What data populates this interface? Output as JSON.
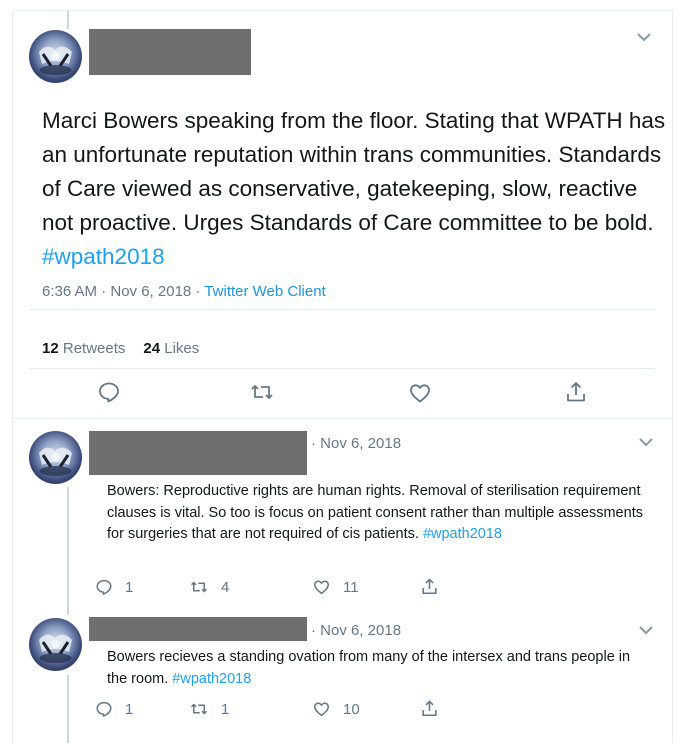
{
  "main_tweet": {
    "text": "Marci Bowers speaking from the floor. Stating that WPATH has an unfortunate reputation within trans communities. Standards of Care viewed as conservative, gatekeeping, slow, reactive not proactive. Urges Standards of Care committee to be bold.",
    "hashtag": "#wpath2018",
    "time": "6:36 AM · Nov 6, 2018 · ",
    "client": "Twitter Web Client",
    "retweets_count": "12",
    "retweets_label": "Retweets",
    "likes_count": "24",
    "likes_label": "Likes",
    "actions": [
      "reply-icon",
      "retweet-icon",
      "like-icon",
      "share-icon"
    ]
  },
  "replies": [
    {
      "date": "· Nov 6, 2018",
      "text": "Bowers: Reproductive rights are human rights. Removal of sterilisation requirement clauses is vital. So too is focus on patient consent rather than multiple assessments for surgeries that are not required of cis patients.",
      "hashtag": "#wpath2018",
      "reply_count": "1",
      "retweet_count": "4",
      "like_count": "11"
    },
    {
      "date": "· Nov 6, 2018",
      "text": "Bowers recieves a standing ovation from many of the intersex and trans people in the room.",
      "hashtag": "#wpath2018",
      "reply_count": "1",
      "retweet_count": "1",
      "like_count": "10"
    }
  ],
  "colors": {
    "link": "#1da1f2",
    "secondary_text": "#657786",
    "redaction": "#6f6f6f",
    "divider": "#e6ecf0"
  }
}
